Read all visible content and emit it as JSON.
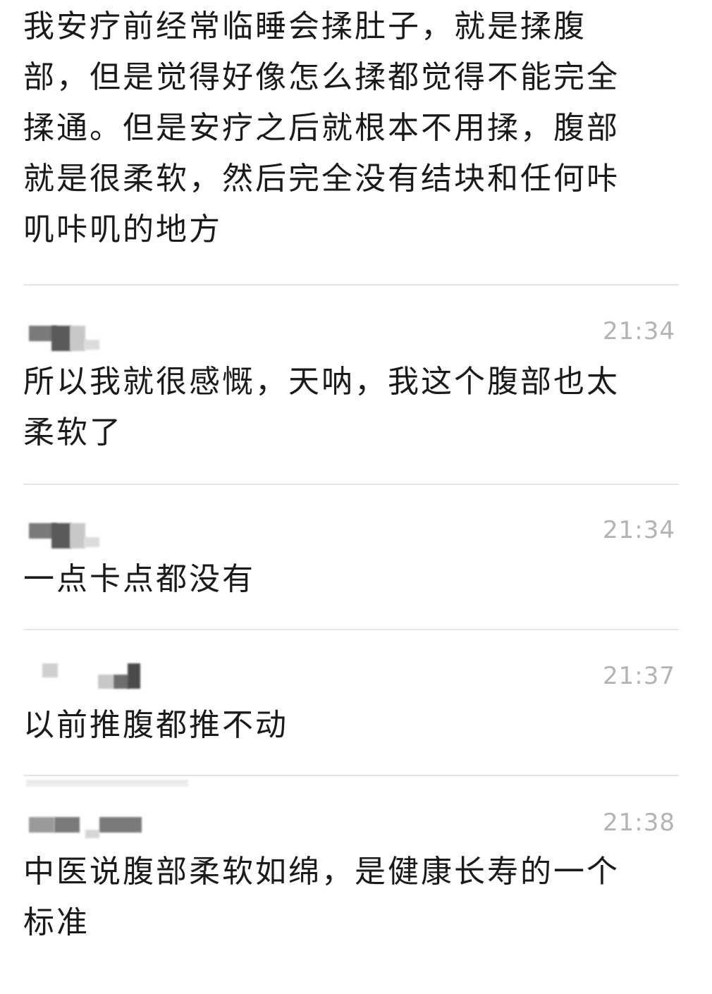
{
  "messages": [
    {
      "time": "",
      "text": "我安疗前经常临睡会揉肚子，就是揉腹部，但是觉得好像怎么揉都觉得不能完全揉通。但是安疗之后就根本不用揉，腹部就是很柔软，然后完全没有结块和任何咔叽咔叽的地方"
    },
    {
      "time": "21:34",
      "text": "所以我就很感慨，天呐，我这个腹部也太柔软了"
    },
    {
      "time": "21:34",
      "text": "一点卡点都没有"
    },
    {
      "time": "21:37",
      "text": "以前推腹都推不动"
    },
    {
      "time": "21:38",
      "text": "中医说腹部柔软如绵，是健康长寿的一个标准"
    }
  ],
  "icons": {
    "avatar": "blurred-username-mosaic"
  },
  "colors": {
    "text": "#1a1a1a",
    "timestamp": "#b3b3b3",
    "divider": "#e6e6e6",
    "background": "#ffffff"
  }
}
